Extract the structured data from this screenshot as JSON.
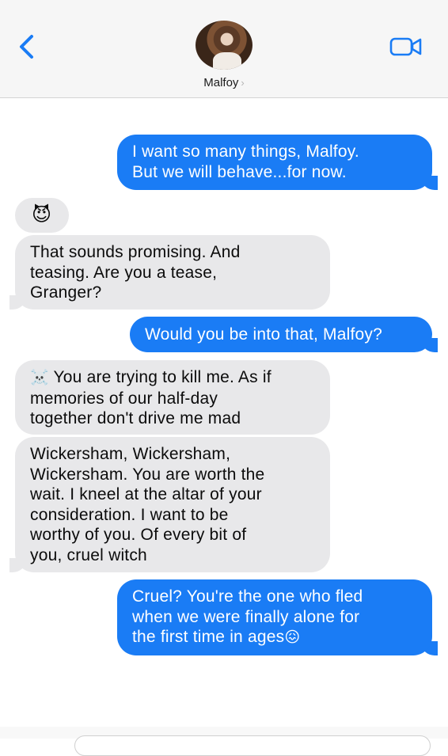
{
  "header": {
    "contact_name": "Malfoy",
    "name_chevron": "›",
    "back_icon": "chevron-left-icon",
    "video_icon": "video-camera-icon",
    "accent_color": "#1a7cf5"
  },
  "messages": [
    {
      "direction": "sent",
      "text": "I want so many things, Malfoy.\nBut we will behave...for now."
    },
    {
      "direction": "received",
      "text": "😈"
    },
    {
      "direction": "received",
      "text": "That sounds promising. And\nteasing. Are you a tease,\nGranger?"
    },
    {
      "direction": "sent",
      "text": "Would you be into that, Malfoy?"
    },
    {
      "direction": "received",
      "emoji": "☠️",
      "text": " You are trying to kill me. As if\nmemories of our half-day\ntogether don't drive me mad"
    },
    {
      "direction": "received",
      "text": "Wickersham, Wickersham,\nWickersham. You are worth the\nwait. I kneel at the altar of your\nconsideration. I want to be\nworthy of you. Of every bit of\nyou, cruel witch"
    },
    {
      "direction": "sent",
      "text": "Cruel? You're the one who fled\nwhen we were finally alone for\nthe first time in ages",
      "emoji": "😖"
    }
  ],
  "colors": {
    "sent_bubble": "#1a7cf5",
    "received_bubble": "#e8e8ea",
    "header_bg": "#f6f6f6"
  }
}
